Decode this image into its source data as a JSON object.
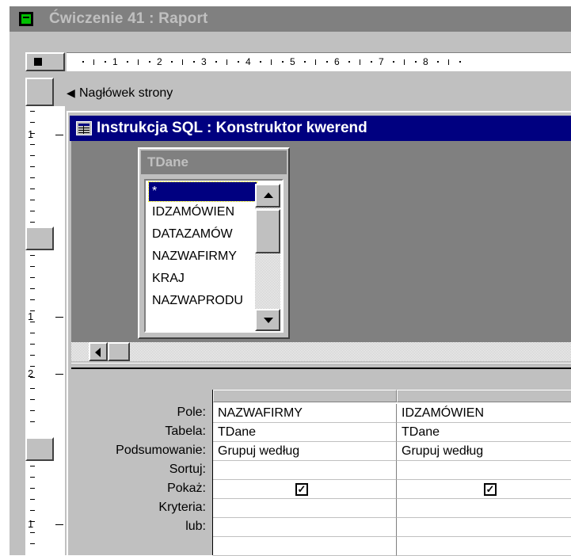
{
  "window": {
    "title": "Ćwiczenie 41 : Raport",
    "icon": "report-icon"
  },
  "ruler": {
    "numbers": [
      "1",
      "2",
      "3",
      "4",
      "5",
      "6",
      "7",
      "8"
    ],
    "left_numbers": [
      "1",
      "1",
      "2",
      "1"
    ]
  },
  "section": {
    "label": "Nagłówek strony",
    "icon": "section-arrow-icon"
  },
  "query_window": {
    "title": "Instrukcja SQL : Konstruktor kwerend",
    "icon": "query-icon"
  },
  "table": {
    "name": "TDane",
    "fields": [
      "*",
      "IDZAMÓWIEN",
      "DATAZAMÓW",
      "NAZWAFIRMY",
      "KRAJ",
      "NAZWAPRODU"
    ]
  },
  "grid": {
    "row_labels": [
      "Pole:",
      "Tabela:",
      "Podsumowanie:",
      "Sortuj:",
      "Pokaż:",
      "Kryteria:",
      "lub:"
    ],
    "columns": [
      {
        "field": "NAZWAFIRMY",
        "table": "TDane",
        "total": "Grupuj według",
        "sort": "",
        "show": true,
        "criteria": "",
        "or": ""
      },
      {
        "field": "IDZAMÓWIEN",
        "table": "TDane",
        "total": "Grupuj według",
        "sort": "",
        "show": true,
        "criteria": "",
        "or": ""
      }
    ]
  },
  "colors": {
    "active_title": "#000080",
    "inactive_title": "#808080",
    "face": "#c0c0c0"
  }
}
